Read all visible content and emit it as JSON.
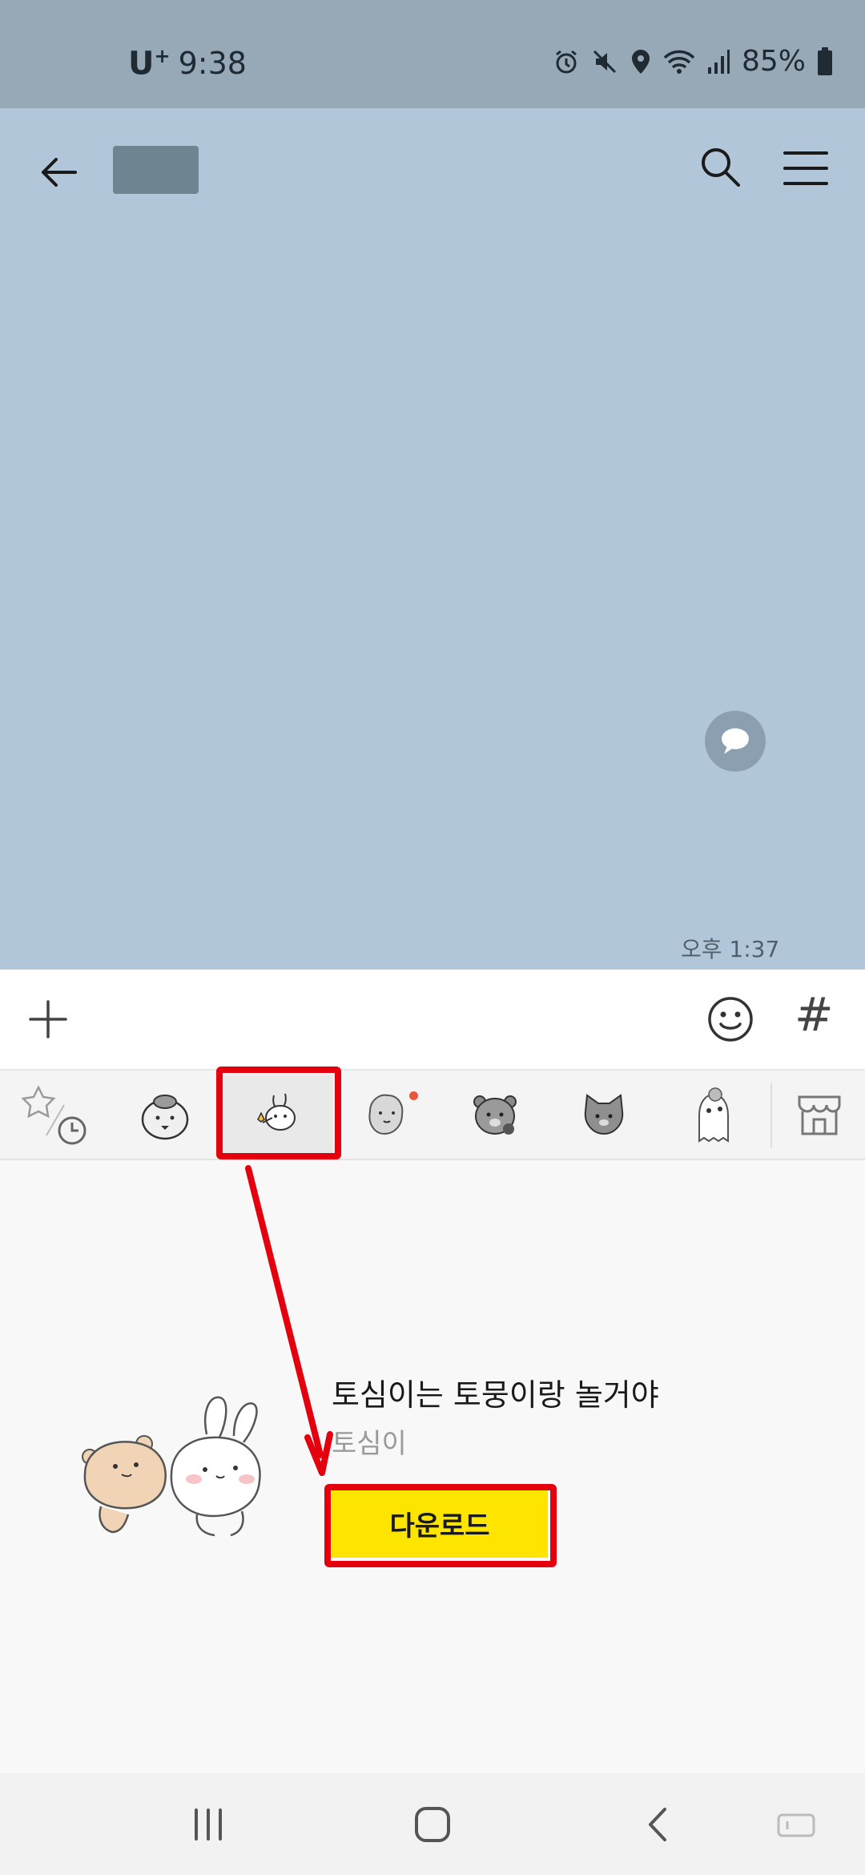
{
  "status_bar": {
    "carrier": "U",
    "carrier_sup": "+",
    "time": "9:38",
    "battery": "85%",
    "icons": [
      "alarm-icon",
      "mute-icon",
      "location-icon",
      "wifi-icon",
      "signal-icon",
      "battery-icon"
    ]
  },
  "chat": {
    "background_color": "#b2c6da",
    "message_time": "오후 1:37",
    "icons": [
      "back-arrow-icon",
      "search-icon",
      "hamburger-menu-icon",
      "speech-bubble-icon"
    ]
  },
  "input_bar": {
    "hash_label": "#",
    "icons": [
      "plus-icon",
      "emoji-icon"
    ]
  },
  "sticker_tabs": {
    "items": [
      "recent-favorites",
      "sticker-pack-1",
      "sticker-pack-tosimi",
      "sticker-pack-3",
      "sticker-pack-4",
      "sticker-pack-5",
      "sticker-pack-6",
      "emoticon-shop"
    ],
    "selected_index": 2
  },
  "sticker_panel": {
    "title": "토심이는 토뭉이랑 놀거야",
    "author": "토심이",
    "download_label": "다운로드",
    "download_color": "#fee500"
  },
  "annotation": {
    "color": "#e4000d"
  },
  "nav_bar": {
    "icons": [
      "recent-apps-icon",
      "home-icon",
      "back-icon",
      "keyboard-hide-icon"
    ]
  }
}
